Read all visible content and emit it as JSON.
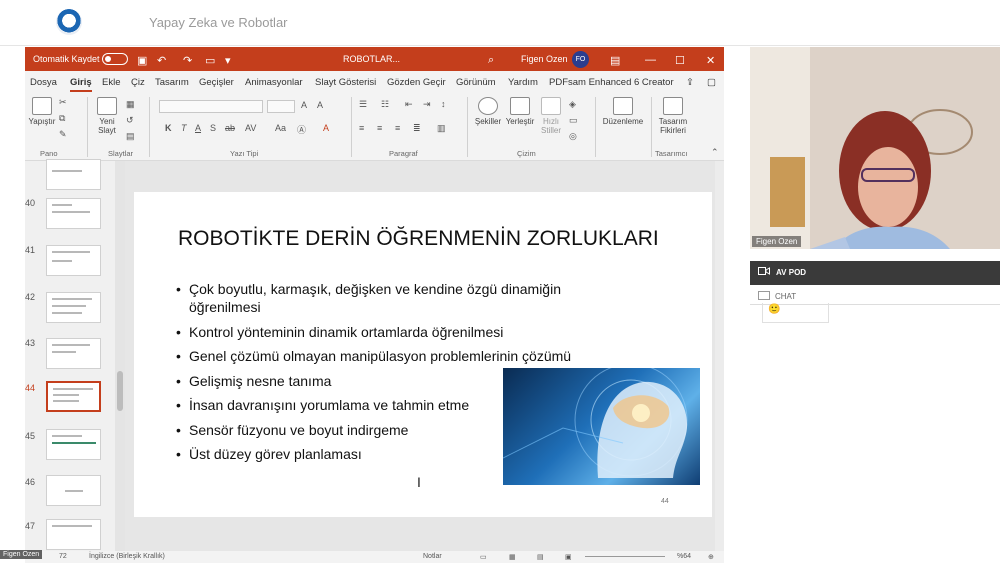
{
  "meeting": {
    "title": "Yapay Zeka ve Robotlar"
  },
  "ppt": {
    "titlebar": {
      "autosave_label": "Otomatik Kaydet",
      "doc_title": "ROBOTLAR...",
      "user_name": "Figen Ozen",
      "user_initials": "FO"
    },
    "menu_tabs": [
      "Dosya",
      "Giriş",
      "Ekle",
      "Çiz",
      "Tasarım",
      "Geçişler",
      "Animasyonlar",
      "Slayt Gösterisi",
      "Gözden Geçir",
      "Görünüm",
      "Yardım",
      "PDFsam Enhanced 6 Creator"
    ],
    "ribbon": {
      "paste": "Yapıştır",
      "new_slide_1": "Yeni",
      "new_slide_2": "Slayt",
      "shapes": "Şekiller",
      "arrange": "Yerleştir",
      "quick_styles_1": "Hızlı",
      "quick_styles_2": "Stiller",
      "editing": "Düzenleme",
      "designer_1": "Tasarım",
      "designer_2": "Fikirleri",
      "groups": {
        "clipboard": "Pano",
        "slides": "Slaytlar",
        "font": "Yazı Tipi",
        "paragraph": "Paragraf",
        "drawing": "Çizim",
        "designer": "Tasarımcı"
      },
      "font_buttons": [
        "K",
        "T",
        "A",
        "S",
        "ab",
        "AV"
      ]
    },
    "thumbnails": [
      {
        "num": "40"
      },
      {
        "num": "41"
      },
      {
        "num": "42"
      },
      {
        "num": "43"
      },
      {
        "num": "44"
      },
      {
        "num": "45"
      },
      {
        "num": "46"
      },
      {
        "num": "47"
      }
    ],
    "slide": {
      "title": "ROBOTİKTE DERİN ÖĞRENMENİN ZORLUKLARI",
      "bullets": [
        "Çok boyutlu, karmaşık, değişken ve kendine özgü dinamiğin öğrenilmesi",
        "Kontrol yönteminin dinamik ortamlarda öğrenilmesi",
        "Genel çözümü olmayan manipülasyon problemlerinin çözümü",
        "Gelişmiş nesne tanıma",
        "İnsan davranışını yorumlama  ve tahmin etme",
        "Sensör füzyonu ve boyut indirgeme",
        "Üst düzey görev planlaması"
      ],
      "page_number": "44"
    },
    "statusbar": {
      "slide_count": "72",
      "language": "İngilizce (Birleşik Krallık)",
      "notes": "Notlar",
      "zoom": "%64"
    }
  },
  "side_panel": {
    "speaker_name": "Figen Ozen",
    "av_label": "AV POD",
    "chat_label": "CHAT",
    "chat_emoji": "🙂"
  },
  "bottom_name": "Figen Ozen",
  "colors": {
    "ppt_accent": "#c43e1c",
    "avatar": "#2b3d8f"
  }
}
